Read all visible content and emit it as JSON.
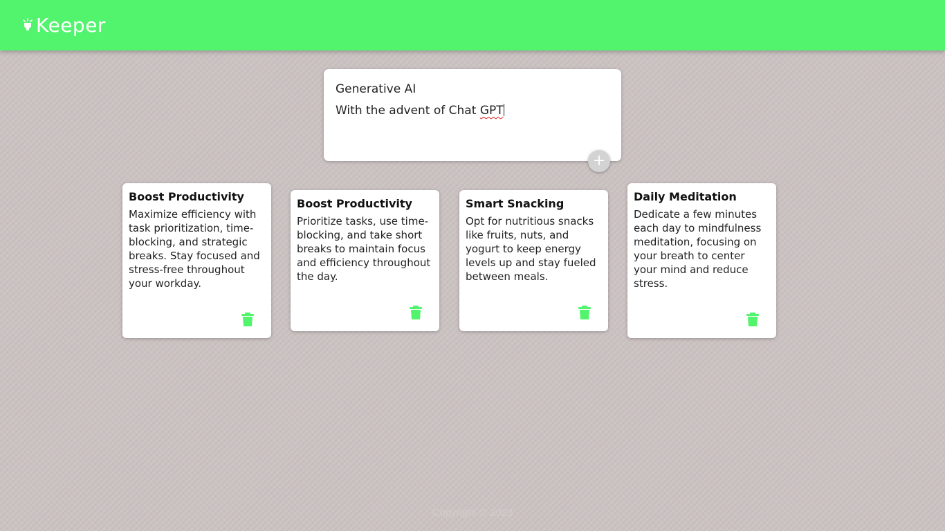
{
  "header": {
    "logo_text": "Keeper",
    "logo_icon": "lightbulb-icon",
    "accent_color": "#52f46d"
  },
  "composer": {
    "title_value": "Generative AI",
    "body_value_plain": "With the advent of Chat ",
    "body_value_flagged": "GPT",
    "add_icon": "plus-icon",
    "add_label": "+"
  },
  "notes": [
    {
      "title": "Boost Productivity",
      "content": "Maximize efficiency with task prioritization, time-blocking, and strategic breaks. Stay focused and stress-free throughout your workday.",
      "delete_icon": "trash-icon"
    },
    {
      "title": "Boost Productivity",
      "content": "Prioritize tasks, use time-blocking, and take short breaks to maintain focus and efficiency throughout the day.",
      "delete_icon": "trash-icon"
    },
    {
      "title": "Smart Snacking",
      "content": "Opt for nutritious snacks like fruits, nuts, and yogurt to keep energy levels up and stay fueled between meals.",
      "delete_icon": "trash-icon"
    },
    {
      "title": "Daily Meditation",
      "content": "Dedicate a few minutes each day to mindfulness meditation, focusing on your breath to center your mind and reduce stress.",
      "delete_icon": "trash-icon"
    }
  ],
  "footer": {
    "text": "Copyright © 2023"
  }
}
